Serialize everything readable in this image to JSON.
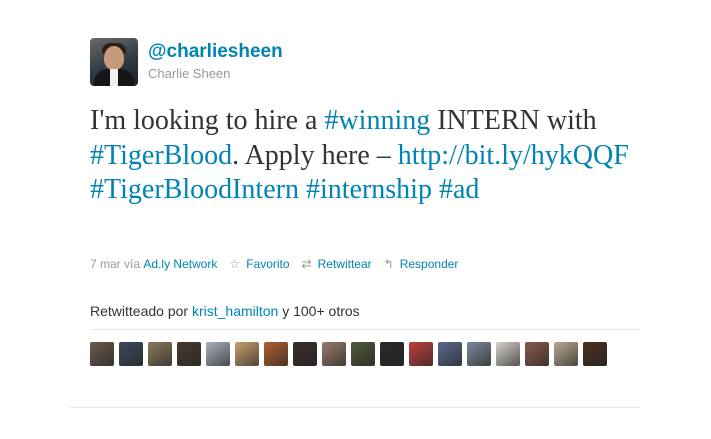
{
  "author": {
    "screen_name": "@charliesheen",
    "full_name": "Charlie Sheen",
    "avatar_icon": "user-avatar"
  },
  "tweet": {
    "parts": [
      {
        "text": "I'm looking to hire a ",
        "link": false
      },
      {
        "text": "#winning",
        "link": true
      },
      {
        "text": " INTERN with ",
        "link": false
      },
      {
        "text": "#TigerBlood",
        "link": true
      },
      {
        "text": ". Apply here – ",
        "link": false
      },
      {
        "text": "http://bit.ly/hykQQF",
        "link": true
      },
      {
        "text": " ",
        "link": false
      },
      {
        "text": "#TigerBloodIntern",
        "link": true
      },
      {
        "text": " ",
        "link": false
      },
      {
        "text": "#internship",
        "link": true
      },
      {
        "text": " ",
        "link": false
      },
      {
        "text": "#ad",
        "link": true
      }
    ]
  },
  "meta": {
    "date": "7 mar",
    "via_label": "vía",
    "via_app": "Ad.ly Network",
    "favorite_label": "Favorito",
    "retweet_label": "Retwittear",
    "reply_label": "Responder",
    "favorite_icon": "star-icon",
    "retweet_icon": "retweet-icon",
    "reply_icon": "reply-icon"
  },
  "retweets": {
    "prefix": "Retwitteado por",
    "user": "krist_hamilton",
    "suffix": "y 100+ otros",
    "avatar_colors": [
      "#6b5a4a",
      "#3d4a5c",
      "#8a7a5a",
      "#4a3a2e",
      "#a9b2bc",
      "#c8a070",
      "#b06030",
      "#3a2e2a",
      "#9a7d6a",
      "#4e5a3a",
      "#2a2a2a",
      "#c04040",
      "#5a6a8a",
      "#7a8a9a",
      "#d6d0c8",
      "#8a5a4a",
      "#b8a890",
      "#4a3020"
    ]
  },
  "colors": {
    "link": "#0084b4",
    "text": "#333333",
    "muted": "#999999"
  }
}
